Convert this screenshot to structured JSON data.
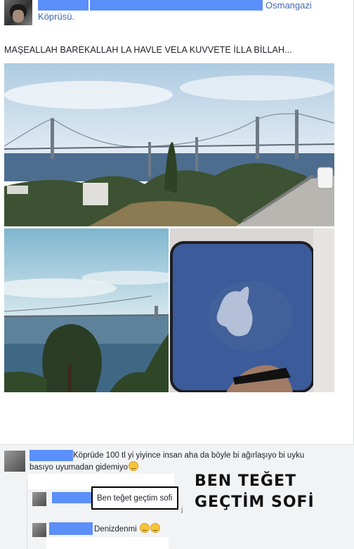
{
  "post": {
    "place_link": "Osmangazi",
    "place_link_cont": "Köprüsü.",
    "text": "MAŞEALLAH BAREKALLAH LA HAVLE VELA KUVVETE İLLA BİLLAH..."
  },
  "comments": [
    {
      "text_line1": "Köprüde 100 tl yi yiyince insan aha da böyle bi ağırlaşıyo bi uyku",
      "text_line2": "basıyo uyumadan gidemiyo"
    },
    {
      "text": "Ben teğet geçtim sofi",
      "marker": "j"
    },
    {
      "text": "Denizdenmi"
    }
  ],
  "overlay": {
    "line1": "BEN TEĞET",
    "line2": "GEÇTİM SOFİ"
  },
  "colors": {
    "link": "#4267b2",
    "redaction": "#5b8ff9",
    "comment_bg": "#f2f3f5"
  }
}
